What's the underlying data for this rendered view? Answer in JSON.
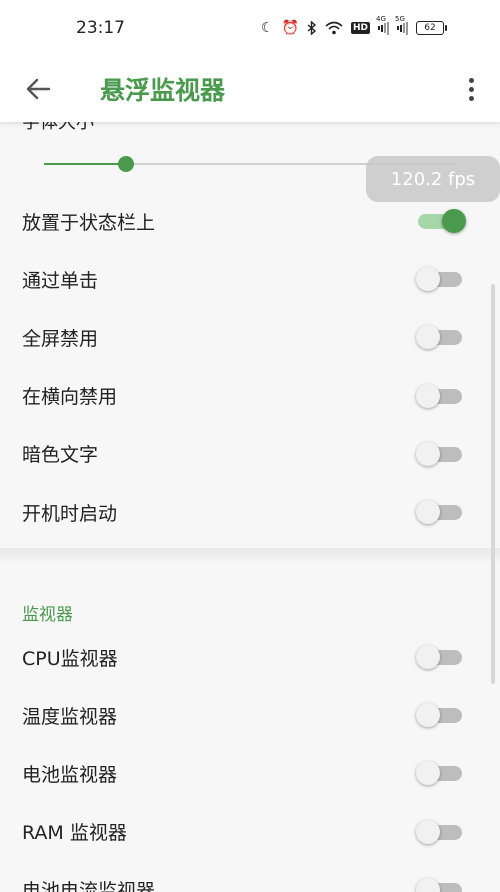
{
  "status_bar": {
    "time": "23:17",
    "hd_label": "HD",
    "signal1_label": "4G",
    "signal2_label": "5G",
    "battery": "62"
  },
  "app_bar": {
    "title": "悬浮监视器",
    "back_icon": "arrow-back-icon",
    "more_icon": "more-vert-icon"
  },
  "font_size_label": "字体大小",
  "slider": {
    "value_percent": 20
  },
  "fps_badge": "120.2 fps",
  "settings": [
    {
      "label": "放置于状态栏上",
      "on": true
    },
    {
      "label": "通过单击",
      "on": false
    },
    {
      "label": "全屏禁用",
      "on": false
    },
    {
      "label": "在横向禁用",
      "on": false
    },
    {
      "label": "暗色文字",
      "on": false
    },
    {
      "label": "开机时启动",
      "on": false
    }
  ],
  "monitors_section": {
    "header": "监视器",
    "items": [
      {
        "label": "CPU监视器",
        "on": false
      },
      {
        "label": "温度监视器",
        "on": false
      },
      {
        "label": "电池监视器",
        "on": false
      },
      {
        "label": "RAM 监视器",
        "on": false
      },
      {
        "label": "电池电流监视器",
        "on": false
      }
    ]
  },
  "colors": {
    "accent": "#4a9a4e",
    "accent_light": "#a6d7a8",
    "switch_off_track": "#bdbdbd",
    "background": "#f7f7f7"
  }
}
